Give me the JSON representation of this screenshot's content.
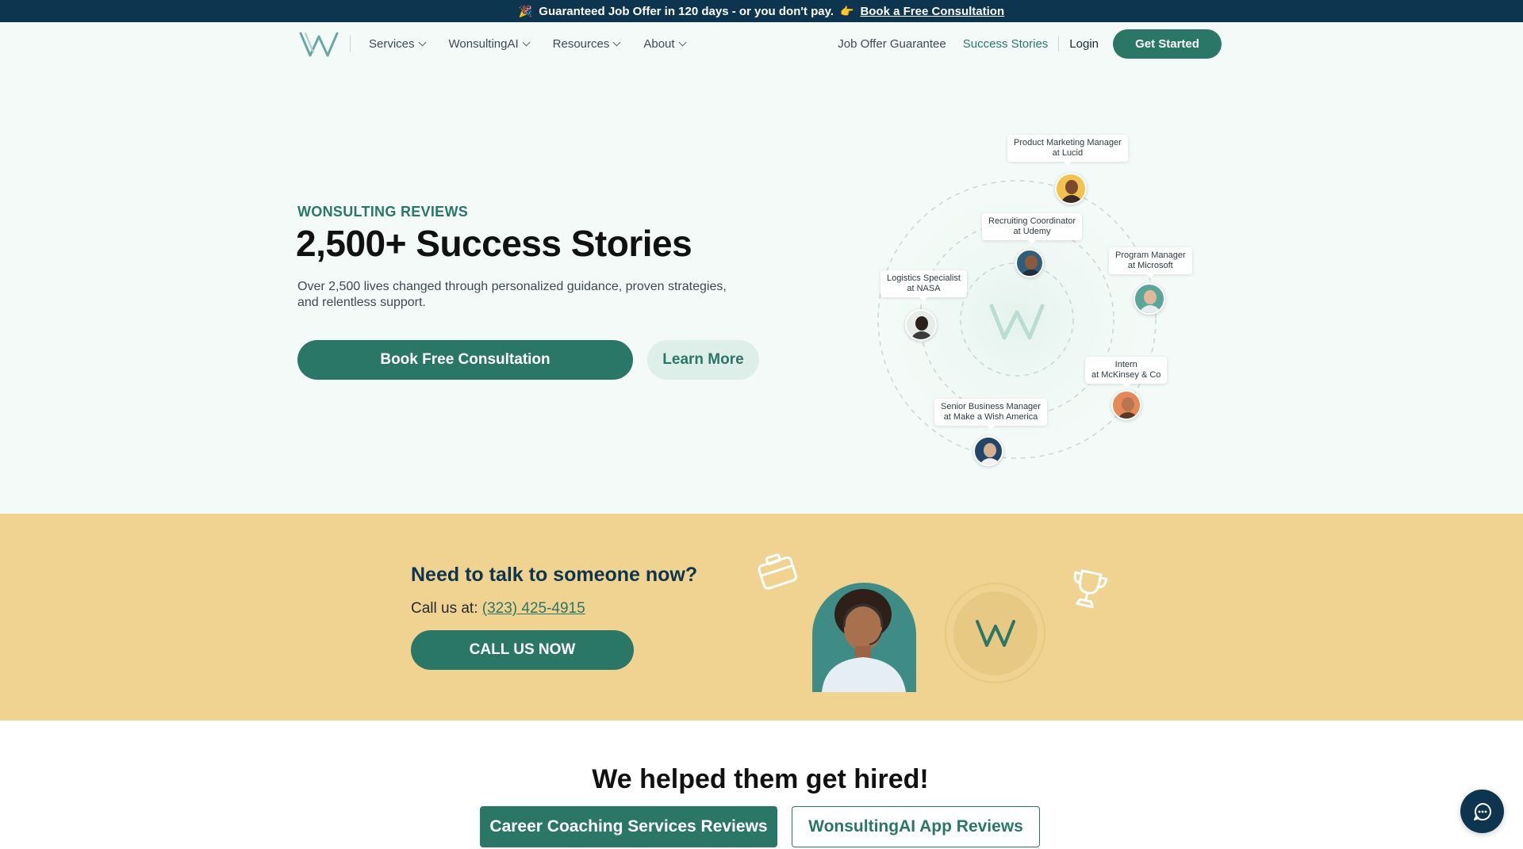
{
  "topbar": {
    "emoji_left": "🎉",
    "message": "Guaranteed Job Offer in 120 days - or you don't pay.",
    "emoji_right": "👉",
    "link": "Book a Free Consultation"
  },
  "nav": {
    "logo_icon": "wonsulting-w-logo",
    "menu": [
      {
        "label": "Services"
      },
      {
        "label": "WonsultingAI"
      },
      {
        "label": "Resources"
      },
      {
        "label": "About"
      }
    ],
    "job_offer_guarantee": "Job Offer Guarantee",
    "success_stories": "Success Stories",
    "login": "Login",
    "get_started": "Get Started"
  },
  "hero": {
    "eyebrow": "WONSULTING REVIEWS",
    "title": "2,500+ Success Stories",
    "description": "Over 2,500 lives changed through personalized guidance, proven strategies, and relentless support.",
    "primary_button": "Book Free Consultation",
    "secondary_button": "Learn More"
  },
  "orbit": {
    "people": [
      {
        "line1": "Product Marketing Manager",
        "line2": "at Lucid"
      },
      {
        "line1": "Recruiting Coordinator",
        "line2": "at Udemy"
      },
      {
        "line1": "Program Manager",
        "line2": "at Microsoft"
      },
      {
        "line1": "Logistics Specialist",
        "line2": "at NASA"
      },
      {
        "line1": "Intern",
        "line2": "at McKinsey & Co"
      },
      {
        "line1": "Senior Business Manager",
        "line2": "at Make a Wish America"
      }
    ]
  },
  "callband": {
    "title": "Need to talk to someone now?",
    "call_prefix": "Call us at:",
    "phone": "(323) 425-4915",
    "button": "CALL US NOW",
    "icons": [
      "briefcase-icon",
      "trophy-icon"
    ]
  },
  "reviews": {
    "title": "We helped them get hired!",
    "tabs": [
      "Career Coaching Services Reviews",
      "WonsultingAI App Reviews"
    ]
  },
  "colors": {
    "brand_teal": "#2a7768",
    "navy": "#0e3550",
    "band_yellow": "#f0d291",
    "page_bg": "#f3faf7"
  }
}
